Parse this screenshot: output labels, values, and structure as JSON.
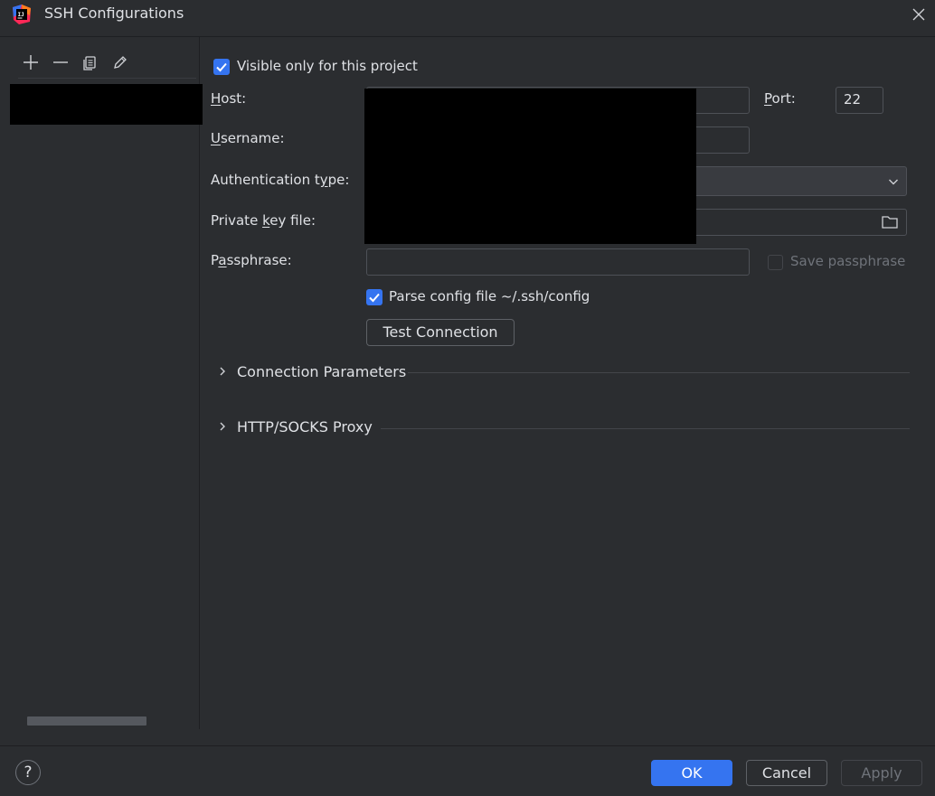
{
  "window": {
    "title": "SSH Configurations"
  },
  "form": {
    "visible_only_label": "Visible only for this project",
    "visible_only_checked": true,
    "host_label_u": "H",
    "host_label_rest": "ost:",
    "port_label_u": "P",
    "port_label_rest": "ort:",
    "port_value": "22",
    "username_label_u": "U",
    "username_label_rest": "sername:",
    "auth_label_pre": "Authentication t",
    "auth_label_u": "y",
    "auth_label_post": "pe:",
    "key_label_pre": "Private ",
    "key_label_u": "k",
    "key_label_post": "ey file:",
    "passphrase_label_pre": "P",
    "passphrase_label_u": "a",
    "passphrase_label_post": "ssphrase:",
    "save_passphrase_label": "Save passphrase",
    "save_passphrase_checked": false,
    "parse_config_label": "Parse config file ~/.ssh/config",
    "parse_config_checked": true,
    "test_connection_label": "Test Connection",
    "connection_parameters_label": "Connection Parameters",
    "proxy_label": "HTTP/SOCKS Proxy"
  },
  "footer": {
    "help_label": "?",
    "ok_label": "OK",
    "cancel_label": "Cancel",
    "apply_label": "Apply"
  },
  "colors": {
    "background": "#2b2d30",
    "accent": "#3574f0",
    "border": "#4e5157"
  }
}
